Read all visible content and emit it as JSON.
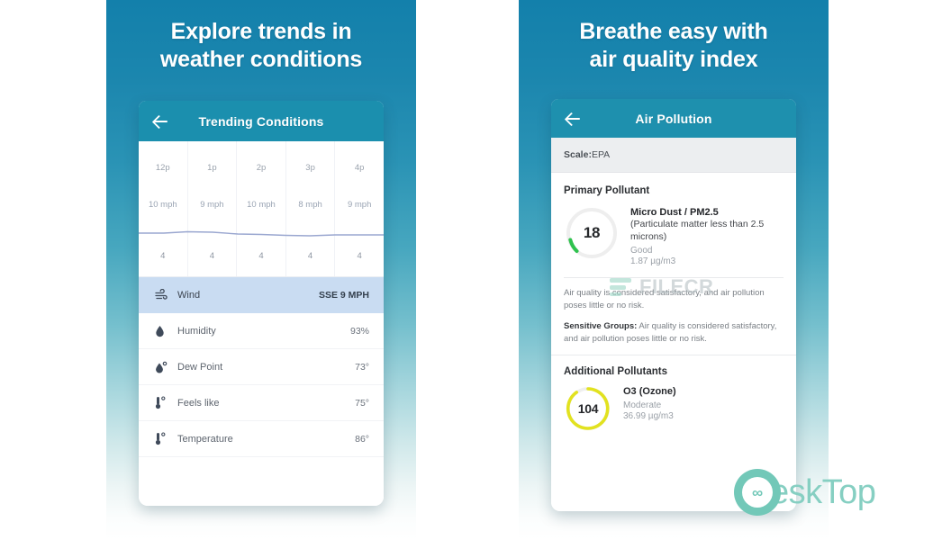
{
  "promos": {
    "left": {
      "title_line1": "Explore trends in",
      "title_line2": "weather conditions"
    },
    "right": {
      "title_line1": "Breathe easy with",
      "title_line2": "air quality index"
    }
  },
  "trending": {
    "appbar": {
      "title": "Trending Conditions",
      "back_icon": "back-arrow-icon"
    },
    "chart": {
      "type": "line",
      "hours": [
        "12p",
        "1p",
        "2p",
        "3p",
        "4p"
      ],
      "speeds": [
        "10 mph",
        "9 mph",
        "10 mph",
        "8 mph",
        "9 mph"
      ],
      "values": [
        "4",
        "4",
        "4",
        "4",
        "4"
      ]
    },
    "rows": [
      {
        "icon": "wind-icon",
        "label": "Wind",
        "value": "SSE 9 MPH",
        "selected": true
      },
      {
        "icon": "humidity-icon",
        "label": "Humidity",
        "value": "93%",
        "selected": false
      },
      {
        "icon": "dew-point-icon",
        "label": "Dew Point",
        "value": "73°",
        "selected": false
      },
      {
        "icon": "feels-like-icon",
        "label": "Feels like",
        "value": "75°",
        "selected": false
      },
      {
        "icon": "temperature-icon",
        "label": "Temperature",
        "value": "86°",
        "selected": false
      }
    ]
  },
  "air": {
    "appbar": {
      "title": "Air Pollution",
      "back_icon": "back-arrow-icon"
    },
    "scale_label": "Scale:",
    "scale_value": " EPA",
    "primary_heading": "Primary Pollutant",
    "primary": {
      "index": "18",
      "name": "Micro Dust / PM2.5",
      "sub": "(Particulate matter less than 2.5 microns)",
      "category": "Good",
      "amount": "1.87 µg/m3",
      "arc_color": "#2fc24e"
    },
    "description": "Air quality is considered satisfactory, and air pollution poses little or no risk.",
    "sensitive_label": "Sensitive Groups:",
    "sensitive_text": " Air quality is considered satisfactory, and air pollution poses little or no risk.",
    "additional_heading": "Additional Pollutants",
    "additional": [
      {
        "index": "104",
        "name": "O3 (Ozone)",
        "category": "Moderate",
        "amount": "36.99 µg/m3",
        "arc_color": "#e2e21f"
      }
    ]
  },
  "watermarks": {
    "filecr": "FILECR",
    "desktop": "eskTop",
    "desktop_logo_glyph": "∞"
  },
  "colors": {
    "panel_top": "#1380ab",
    "appbar": "#1b8fae",
    "selected_row": "#c9dcf2",
    "good": "#2fc24e",
    "moderate": "#e2e21f"
  }
}
